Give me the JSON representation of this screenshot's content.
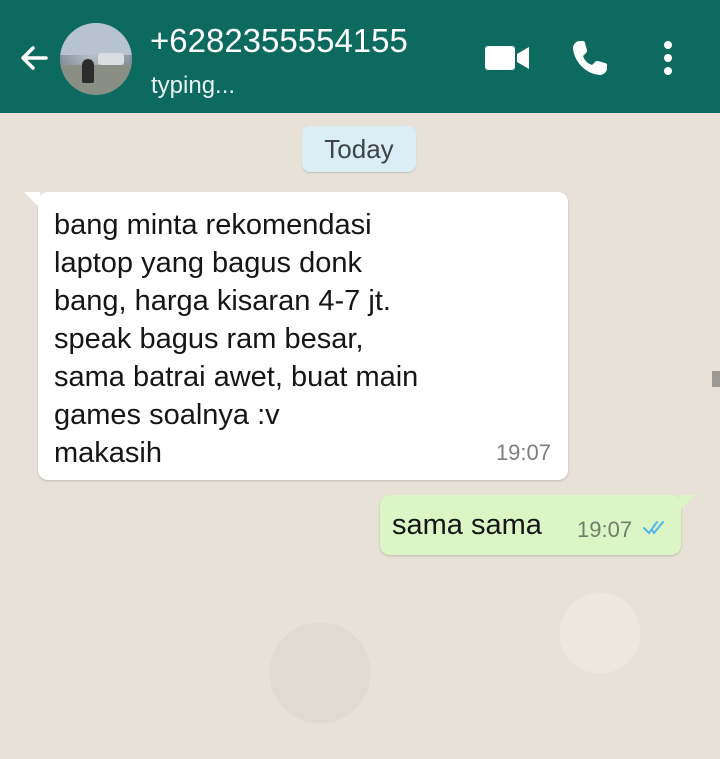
{
  "header": {
    "contact_name": "+6282355554155",
    "status": "typing...",
    "icons": [
      "back-arrow-icon",
      "avatar",
      "video-call-icon",
      "phone-icon",
      "more-vertical-icon"
    ]
  },
  "chat": {
    "date_label": "Today",
    "messages": [
      {
        "direction": "incoming",
        "text": "bang minta rekomendasi\nlaptop yang bagus donk\nbang, harga kisaran 4-7 jt.\nspeak bagus ram besar,\nsama batrai awet, buat main\ngames soalnya :v\nmakasih",
        "time": "19:07"
      },
      {
        "direction": "outgoing",
        "text": "sama sama",
        "time": "19:07",
        "read_status": "read"
      }
    ]
  },
  "colors": {
    "header": "#0c6a5f",
    "chat_background": "#e7e1d7",
    "incoming_bubble": "#ffffff",
    "outgoing_bubble": "#dcf5c4",
    "date_pill": "#dbeef6",
    "read_ticks": "#4fb6ec"
  }
}
